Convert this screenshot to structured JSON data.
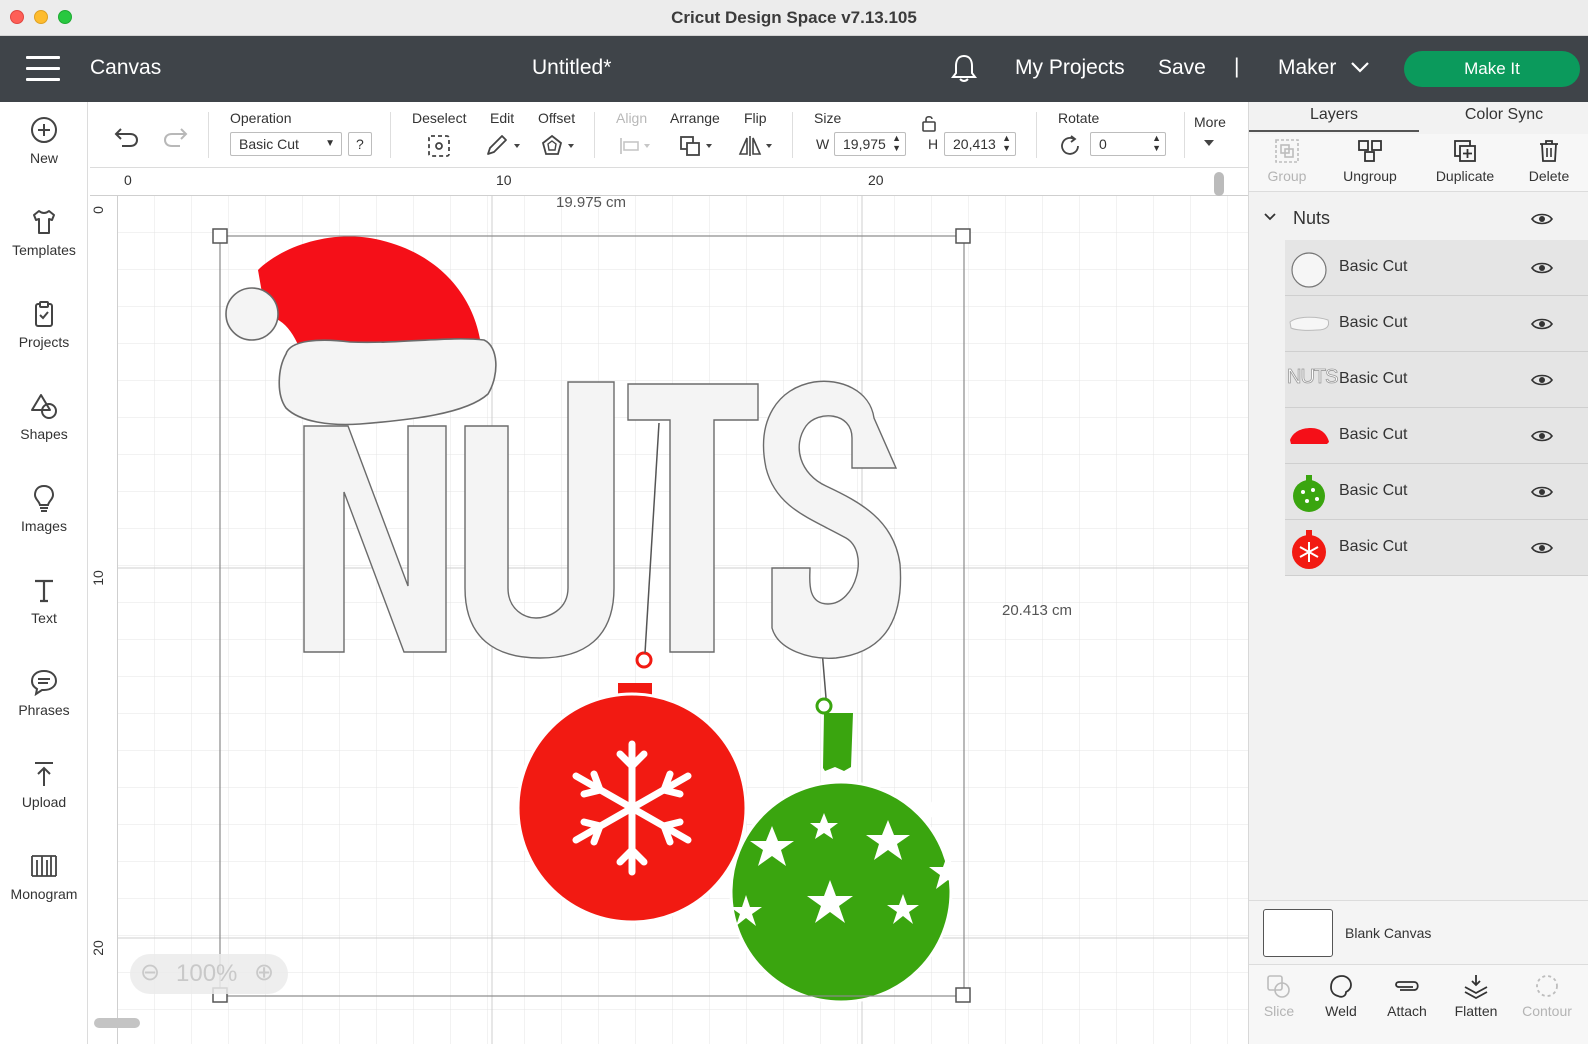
{
  "window": {
    "title": "Cricut Design Space  v7.13.105"
  },
  "header": {
    "section": "Canvas",
    "document": "Untitled*",
    "my_projects": "My Projects",
    "save": "Save",
    "separator": "|",
    "machine": "Maker",
    "make_it": "Make It"
  },
  "nav": [
    {
      "label": "New",
      "icon": "plus-circle-icon"
    },
    {
      "label": "Templates",
      "icon": "shirt-icon"
    },
    {
      "label": "Projects",
      "icon": "clipboard-icon"
    },
    {
      "label": "Shapes",
      "icon": "shapes-icon"
    },
    {
      "label": "Images",
      "icon": "lightbulb-icon"
    },
    {
      "label": "Text",
      "icon": "text-icon"
    },
    {
      "label": "Phrases",
      "icon": "speech-bubble-icon"
    },
    {
      "label": "Upload",
      "icon": "upload-icon"
    },
    {
      "label": "Monogram",
      "icon": "monogram-icon"
    }
  ],
  "toolbar": {
    "operation_label": "Operation",
    "operation_value": "Basic Cut",
    "help": "?",
    "deselect": "Deselect",
    "edit": "Edit",
    "offset": "Offset",
    "align": "Align",
    "arrange": "Arrange",
    "flip": "Flip",
    "size_label": "Size",
    "w_label": "W",
    "w_value": "19,975",
    "h_label": "H",
    "h_value": "20,413",
    "rotate_label": "Rotate",
    "rotate_value": "0",
    "more": "More"
  },
  "canvas": {
    "ruler_top": [
      "0",
      "10",
      "20"
    ],
    "ruler_left": [
      "0",
      "10",
      "20"
    ],
    "width_label": "19.975 cm",
    "height_label": "20.413 cm",
    "zoom": "100%",
    "design_text": "NUTS",
    "colors": {
      "red": "#f21a12",
      "hat_red": "#f50f18",
      "green": "#3aa50f",
      "white_fill": "#f4f4f4"
    }
  },
  "panel": {
    "tabs": [
      "Layers",
      "Color Sync"
    ],
    "actions": [
      "Group",
      "Ungroup",
      "Duplicate",
      "Delete"
    ],
    "group_name": "Nuts",
    "layers": [
      {
        "name": "Basic Cut",
        "thumb": "pompom"
      },
      {
        "name": "Basic Cut",
        "thumb": "hat-trim"
      },
      {
        "name": "Basic Cut",
        "thumb": "nuts-text",
        "thumb_text": "NUTS"
      },
      {
        "name": "Basic Cut",
        "thumb": "hat"
      },
      {
        "name": "Basic Cut",
        "thumb": "green-ornament"
      },
      {
        "name": "Basic Cut",
        "thumb": "red-ornament"
      }
    ],
    "blank_canvas": "Blank Canvas",
    "bottom_actions": [
      "Slice",
      "Weld",
      "Attach",
      "Flatten",
      "Contour"
    ]
  }
}
